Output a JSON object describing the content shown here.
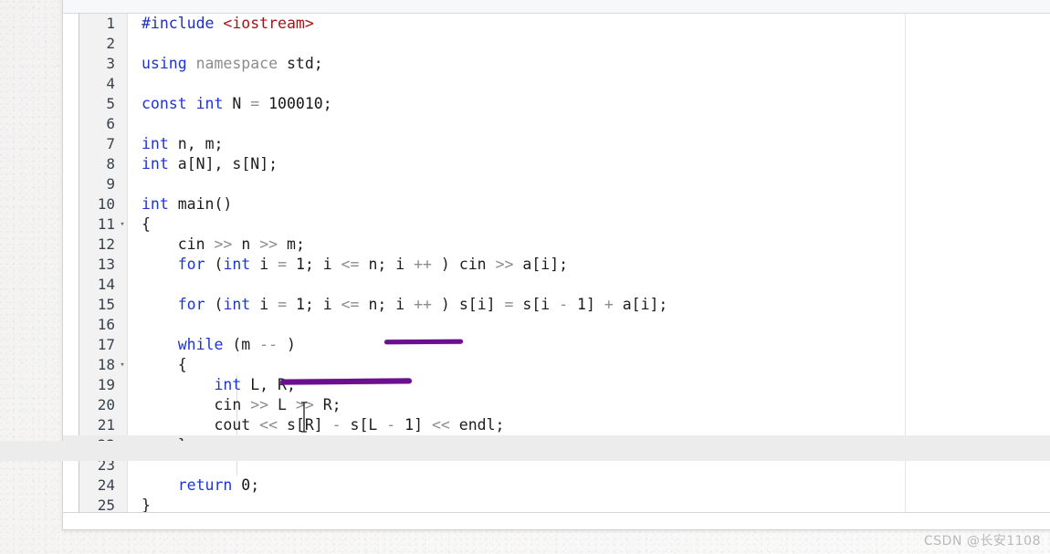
{
  "window": {
    "toolbar_label": "",
    "bottom_panel_label": ""
  },
  "editor": {
    "language": "C++",
    "current_line": 22,
    "fold_lines": [
      11,
      18
    ],
    "colors": {
      "keyword": "#1d35d4",
      "preprocessor": "#1f2fc2",
      "string": "#a31515",
      "comment_gray": "#8c8c8c",
      "plain": "#1d1d1d",
      "gutter_bg": "#f2f2f2",
      "current_line_bg": "#ececec",
      "marker_purple": "#6b0f91",
      "margin_guide": "#e6e6e6"
    },
    "lines": [
      {
        "n": "1",
        "fold": "",
        "text": "#include <iostream>"
      },
      {
        "n": "2",
        "fold": "",
        "text": ""
      },
      {
        "n": "3",
        "fold": "",
        "text": "using namespace std;"
      },
      {
        "n": "4",
        "fold": "",
        "text": ""
      },
      {
        "n": "5",
        "fold": "",
        "text": "const int N = 100010;"
      },
      {
        "n": "6",
        "fold": "",
        "text": ""
      },
      {
        "n": "7",
        "fold": "",
        "text": "int n, m;"
      },
      {
        "n": "8",
        "fold": "",
        "text": "int a[N], s[N];"
      },
      {
        "n": "9",
        "fold": "",
        "text": ""
      },
      {
        "n": "10",
        "fold": "",
        "text": "int main()"
      },
      {
        "n": "11",
        "fold": "▾",
        "text": "{"
      },
      {
        "n": "12",
        "fold": "",
        "text": "    cin >> n >> m;"
      },
      {
        "n": "13",
        "fold": "",
        "text": "    for (int i = 1; i <= n; i ++ ) cin >> a[i];"
      },
      {
        "n": "14",
        "fold": "",
        "text": ""
      },
      {
        "n": "15",
        "fold": "",
        "text": "    for (int i = 1; i <= n; i ++ ) s[i] = s[i - 1] + a[i];"
      },
      {
        "n": "16",
        "fold": "",
        "text": ""
      },
      {
        "n": "17",
        "fold": "",
        "text": "    while (m -- )"
      },
      {
        "n": "18",
        "fold": "▾",
        "text": "    {"
      },
      {
        "n": "19",
        "fold": "",
        "text": "        int L, R;"
      },
      {
        "n": "20",
        "fold": "",
        "text": "        cin >> L >> R;"
      },
      {
        "n": "21",
        "fold": "",
        "text": "        cout << s[R] - s[L - 1] << endl;"
      },
      {
        "n": "22",
        "fold": "",
        "text": "    }"
      },
      {
        "n": "23",
        "fold": "",
        "text": ""
      },
      {
        "n": "24",
        "fold": "",
        "text": "    return 0;"
      },
      {
        "n": "25",
        "fold": "",
        "text": "}"
      }
    ]
  },
  "annotations": {
    "markers": [
      {
        "id": "marker-1",
        "target_line": 15,
        "note": "purple underline under  i <= n  in the second for-loop"
      },
      {
        "id": "marker-2",
        "target_line": 18,
        "note": "purple underline to the right of the opening brace"
      }
    ]
  },
  "watermark": {
    "text": "CSDN @长安1108"
  }
}
